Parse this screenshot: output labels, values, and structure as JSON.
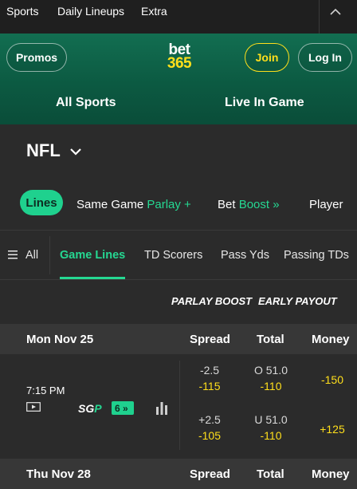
{
  "top_nav": {
    "items": [
      "Sports",
      "Daily Lineups",
      "Extra"
    ]
  },
  "header": {
    "promos_label": "Promos",
    "logo_top": "bet",
    "logo_bottom": "365",
    "join_label": "Join",
    "login_label": "Log In",
    "nav": [
      "All Sports",
      "Live In Game"
    ]
  },
  "colors": {
    "accent_green": "#25d892",
    "odds_yellow": "#ffdf1b",
    "header_green": "#126e51"
  },
  "league": {
    "title": "NFL"
  },
  "sub_tabs": {
    "lines": "Lines",
    "same_game_prefix": "Same Game",
    "same_game_suffix": "Parlay +",
    "bet_prefix": "Bet",
    "bet_suffix": "Boost »",
    "player": "Player"
  },
  "market_tabs": [
    "All",
    "Game Lines",
    "TD Scorers",
    "Pass Yds",
    "Passing TDs"
  ],
  "boosts": [
    "PARLAY BOOST",
    "EARLY PAYOUT"
  ],
  "columns": [
    "Spread",
    "Total",
    "Money"
  ],
  "days": [
    {
      "date": "Mon Nov 25",
      "game": {
        "time": "7:15 PM",
        "sgp_label": "SGP",
        "sgp_count": "6",
        "rows": [
          {
            "spread": "-2.5",
            "spread_odds": "-115",
            "total": "O 51.0",
            "total_odds": "-110",
            "money": "-150"
          },
          {
            "spread": "+2.5",
            "spread_odds": "-105",
            "total": "U 51.0",
            "total_odds": "-110",
            "money": "+125"
          }
        ]
      }
    },
    {
      "date": "Thu Nov 28"
    }
  ]
}
